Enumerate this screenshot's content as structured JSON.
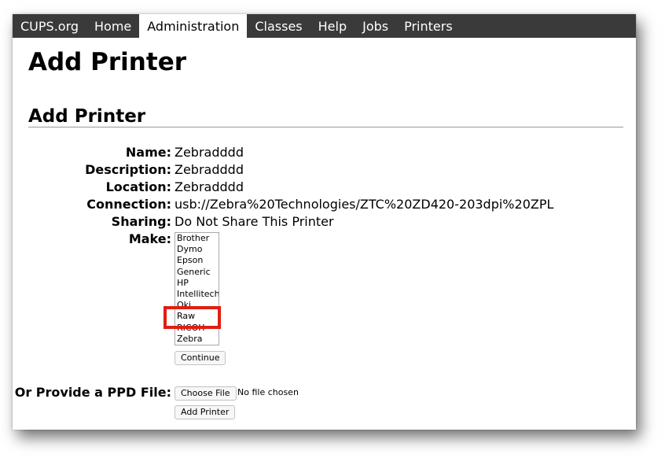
{
  "nav": {
    "items": [
      {
        "label": "CUPS.org"
      },
      {
        "label": "Home"
      },
      {
        "label": "Administration"
      },
      {
        "label": "Classes"
      },
      {
        "label": "Help"
      },
      {
        "label": "Jobs"
      },
      {
        "label": "Printers"
      }
    ],
    "active_index": 2
  },
  "page": {
    "title": "Add Printer",
    "section_title": "Add Printer"
  },
  "form": {
    "name": {
      "label": "Name:",
      "value": "Zebradddd"
    },
    "description": {
      "label": "Description:",
      "value": "Zebradddd"
    },
    "location": {
      "label": "Location:",
      "value": "Zebradddd"
    },
    "connection": {
      "label": "Connection:",
      "value": "usb://Zebra%20Technologies/ZTC%20ZD420-203dpi%20ZPL"
    },
    "sharing": {
      "label": "Sharing:",
      "value": "Do Not Share This Printer"
    },
    "make": {
      "label": "Make:",
      "options": [
        "Brother",
        "Dymo",
        "Epson",
        "Generic",
        "HP",
        "Intellitech",
        "Oki",
        "Raw",
        "RICOH",
        "Zebra"
      ],
      "highlighted": "Raw"
    },
    "continue_label": "Continue",
    "ppd": {
      "label": "Or Provide a PPD File:",
      "choose_label": "Choose File",
      "file_status": "No file chosen"
    },
    "add_printer_label": "Add Printer"
  },
  "colors": {
    "navbar_bg": "#3a3a3a",
    "highlight_outline": "#e01e12"
  }
}
